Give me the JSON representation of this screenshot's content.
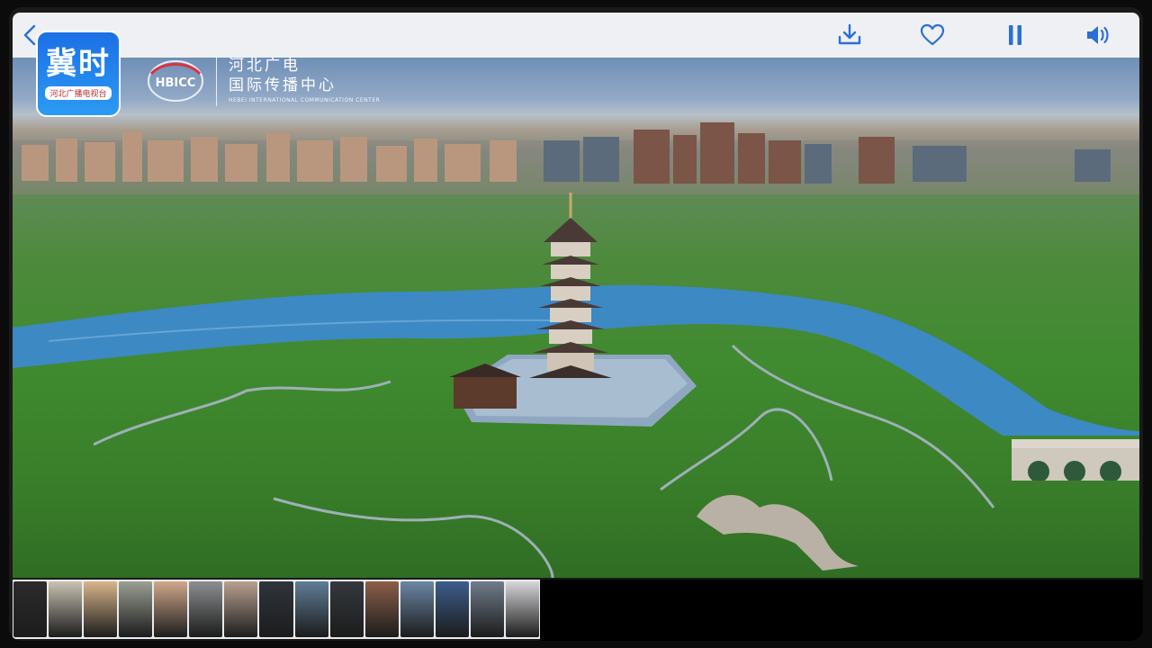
{
  "toolbar": {
    "back_icon": "chevron-left-icon",
    "actions": [
      {
        "name": "download-icon"
      },
      {
        "name": "heart-icon"
      },
      {
        "name": "pause-icon"
      },
      {
        "name": "volume-icon"
      }
    ],
    "accent": "#2b6fd6"
  },
  "overlay": {
    "logo_text": "冀时",
    "logo_sub": "河北广播电视台",
    "org_line1": "河北广电",
    "org_line2": "国际传播中心",
    "org_en": "HEBEI INTERNATIONAL COMMUNICATION CENTER",
    "bicc_text": "HBICC"
  },
  "filmstrip": {
    "thumbs": [
      {
        "color": "#2b2b2b"
      },
      {
        "color": "#c9c2b3"
      },
      {
        "color": "#d9b58a"
      },
      {
        "color": "#9aa093"
      },
      {
        "color": "#cfa88b"
      },
      {
        "color": "#8c8f90"
      },
      {
        "color": "#b9a091"
      },
      {
        "color": "#2f353c"
      },
      {
        "color": "#5f7d96"
      },
      {
        "color": "#34383d"
      },
      {
        "color": "#8b5e4a"
      },
      {
        "color": "#6b86a5"
      },
      {
        "color": "#3c5d8c"
      },
      {
        "color": "#6f7c8a"
      },
      {
        "color": "#d6d7d9"
      }
    ]
  }
}
